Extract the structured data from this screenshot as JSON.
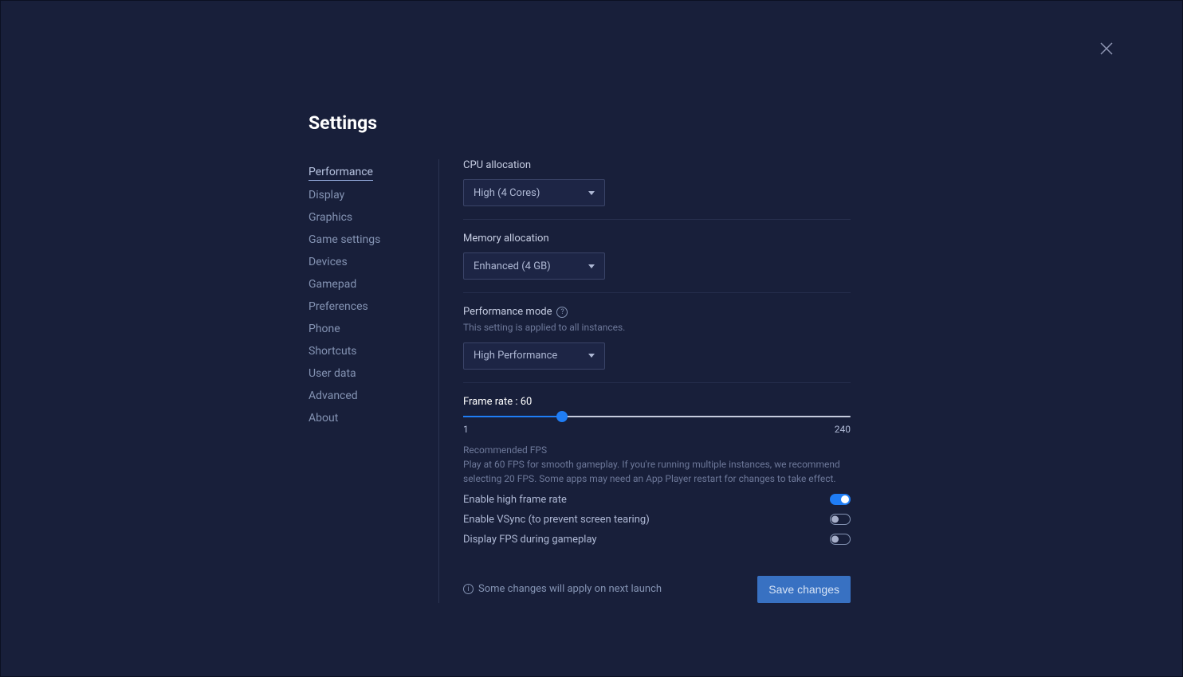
{
  "page_title": "Settings",
  "sidebar": {
    "items": [
      "Performance",
      "Display",
      "Graphics",
      "Game settings",
      "Devices",
      "Gamepad",
      "Preferences",
      "Phone",
      "Shortcuts",
      "User data",
      "Advanced",
      "About"
    ],
    "active": "Performance"
  },
  "cpu": {
    "label": "CPU allocation",
    "value": "High (4 Cores)"
  },
  "memory": {
    "label": "Memory allocation",
    "value": "Enhanced (4 GB)"
  },
  "perf_mode": {
    "label": "Performance mode",
    "subtext": "This setting is applied to all instances.",
    "value": "High Performance"
  },
  "frame_rate": {
    "label": "Frame rate : 60",
    "min": "1",
    "max": "240",
    "value": 60,
    "rec_title": "Recommended FPS",
    "rec_text": "Play at 60 FPS for smooth gameplay. If you're running multiple instances, we recommend selecting 20 FPS. Some apps may need an App Player restart for changes to take effect."
  },
  "toggles": [
    {
      "label": "Enable high frame rate",
      "on": true
    },
    {
      "label": "Enable VSync (to prevent screen tearing)",
      "on": false
    },
    {
      "label": "Display FPS during gameplay",
      "on": false
    }
  ],
  "footer": {
    "notice": "Some changes will apply on next launch",
    "save": "Save changes"
  }
}
